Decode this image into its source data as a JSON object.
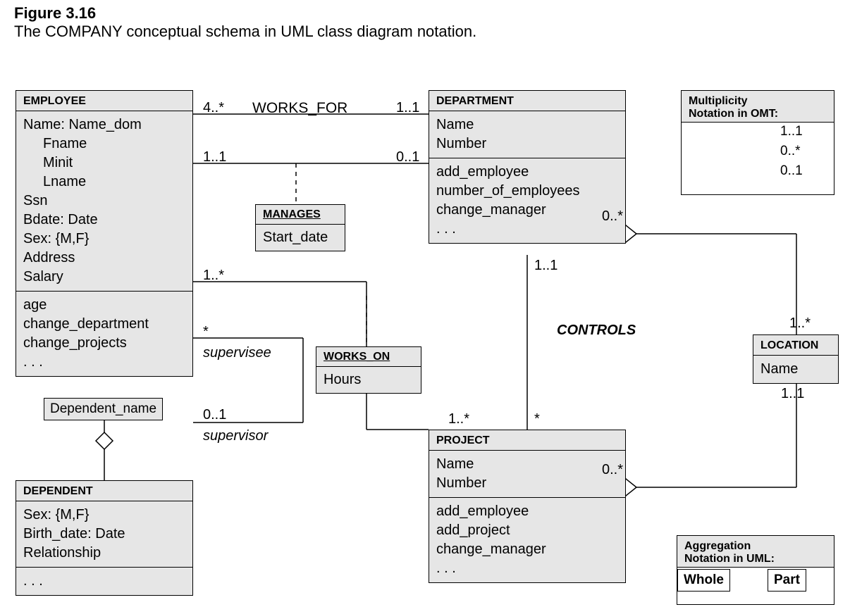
{
  "figure": {
    "label": "Figure 3.16",
    "caption": "The COMPANY conceptual schema in UML class diagram notation."
  },
  "employee": {
    "title": "EMPLOYEE",
    "attrs": {
      "name": "Name: Name_dom",
      "fname": "Fname",
      "minit": "Minit",
      "lname": "Lname",
      "ssn": "Ssn",
      "bdate": "Bdate: Date",
      "sex": "Sex: {M,F}",
      "address": "Address",
      "salary": "Salary"
    },
    "ops": {
      "age": "age",
      "changedept": "change_department",
      "changeproj": "change_projects",
      "more": ". . ."
    }
  },
  "department": {
    "title": "DEPARTMENT",
    "attrs": {
      "name": "Name",
      "number": "Number"
    },
    "ops": {
      "addemp": "add_employee",
      "numemp": "number_of_employees",
      "chmgr": "change_manager",
      "more": ". . ."
    }
  },
  "project": {
    "title": "PROJECT",
    "attrs": {
      "name": "Name",
      "number": "Number"
    },
    "ops": {
      "addemp": "add_employee",
      "addproj": "add_project",
      "chmgr": "change_manager",
      "more": ". . ."
    }
  },
  "dependent": {
    "title": "DEPENDENT",
    "attrs": {
      "sex": "Sex: {M,F}",
      "bdate": "Birth_date: Date",
      "rel": "Relationship"
    },
    "ops": {
      "more": ". . ."
    }
  },
  "location": {
    "title": "LOCATION",
    "attrs": {
      "name": "Name"
    }
  },
  "manages": {
    "title": "MANAGES",
    "attr": "Start_date"
  },
  "workson": {
    "title": "WORKS_ON",
    "attr": "Hours"
  },
  "worksfor": {
    "name": "WORKS_FOR",
    "m_emp": "4..*",
    "m_dept": "1..1"
  },
  "manages_assoc": {
    "m_emp": "1..1",
    "m_dept": "0..1"
  },
  "supervision": {
    "role_sub": "supervisee",
    "role_sup": "supervisor",
    "m_sub": "*",
    "m_sup": "0..1"
  },
  "workson_assoc": {
    "m_emp": "1..*"
  },
  "controls": {
    "name": "CONTROLS",
    "m_dept": "1..1",
    "m_proj": "1..*",
    "m_proj_side": "*"
  },
  "dept_loc": {
    "m_dept": "0..*",
    "m_loc": "1..*"
  },
  "proj_loc": {
    "m_proj": "0..*",
    "m_loc": "1..1"
  },
  "depname": {
    "label": "Dependent_name"
  },
  "legend1": {
    "title1": "Multiplicity",
    "title2": "Notation in OMT:",
    "rows": {
      "r1": "1..1",
      "r2": "0..*",
      "r3": "0..1"
    }
  },
  "legend2": {
    "title1": "Aggregation",
    "title2": "Notation in UML:",
    "whole": "Whole",
    "part": "Part"
  }
}
